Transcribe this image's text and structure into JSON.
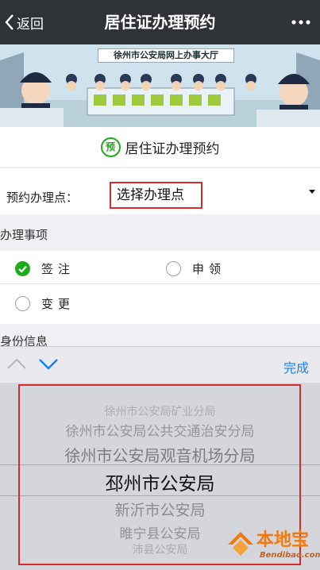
{
  "nav": {
    "back_label": "返回",
    "title": "居住证办理预约"
  },
  "banner": {
    "sign_text": "徐州市公安局网上办事大厅"
  },
  "form": {
    "badge": "预",
    "title": "居住证办理预约",
    "location_label": "预约办理点：",
    "location_value": "选择办理点"
  },
  "matters": {
    "heading": "办理事项",
    "options": [
      {
        "label": "签注",
        "checked": true
      },
      {
        "label": "申领",
        "checked": false
      },
      {
        "label": "变更",
        "checked": false
      }
    ]
  },
  "identity_heading": "身份信息",
  "picker": {
    "done_label": "完成",
    "items": [
      "徐州市公安局矿业分局",
      "徐州市公安局公共交通治安分局",
      "徐州市公安局观音机场分局",
      "邳州市公安局",
      "新沂市公安局",
      "睢宁县公安局",
      "沛县公安局"
    ],
    "selected": "邳州市公安局"
  },
  "watermark": {
    "text": "本地宝",
    "url": "Bendibao.com"
  },
  "colors": {
    "nav_bg": "#2f3236",
    "accent_green": "#1aad19",
    "highlight_red": "#d62b2b",
    "done_blue": "#157efb"
  }
}
